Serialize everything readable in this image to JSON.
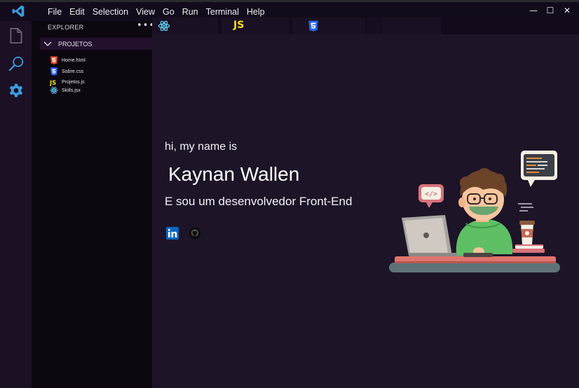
{
  "menu": {
    "items": [
      "File",
      "Edit",
      "Selection",
      "View",
      "Go",
      "Run",
      "Terminal",
      "Help"
    ]
  },
  "window_controls": {
    "minimize": "—",
    "maximize": "☐",
    "close": "✕"
  },
  "explorer": {
    "title": "EXPLORER",
    "more": "•••",
    "folder": "PROJETOS",
    "files": [
      {
        "name": "Home.html",
        "icon": "html5-icon"
      },
      {
        "name": "Sobre.css",
        "icon": "css3-icon"
      },
      {
        "name": "Projetos.js",
        "icon": "js-icon"
      },
      {
        "name": "Skills.jsx",
        "icon": "react-icon"
      }
    ]
  },
  "tabs": [
    {
      "icon": "react-icon"
    },
    {
      "icon": "js-icon",
      "label": "JS"
    },
    {
      "icon": "css3-icon"
    }
  ],
  "hero": {
    "greeting": "hi, my name is",
    "name": "Kaynan Wallen",
    "role": "E sou um desenvolvedor Front-End"
  },
  "colors": {
    "accent_vscode": "#3a9ee0",
    "html": "#e44d26",
    "css": "#2965f1",
    "js": "#f7df1e",
    "react": "#61dafb",
    "linkedin": "#0a66c2"
  }
}
